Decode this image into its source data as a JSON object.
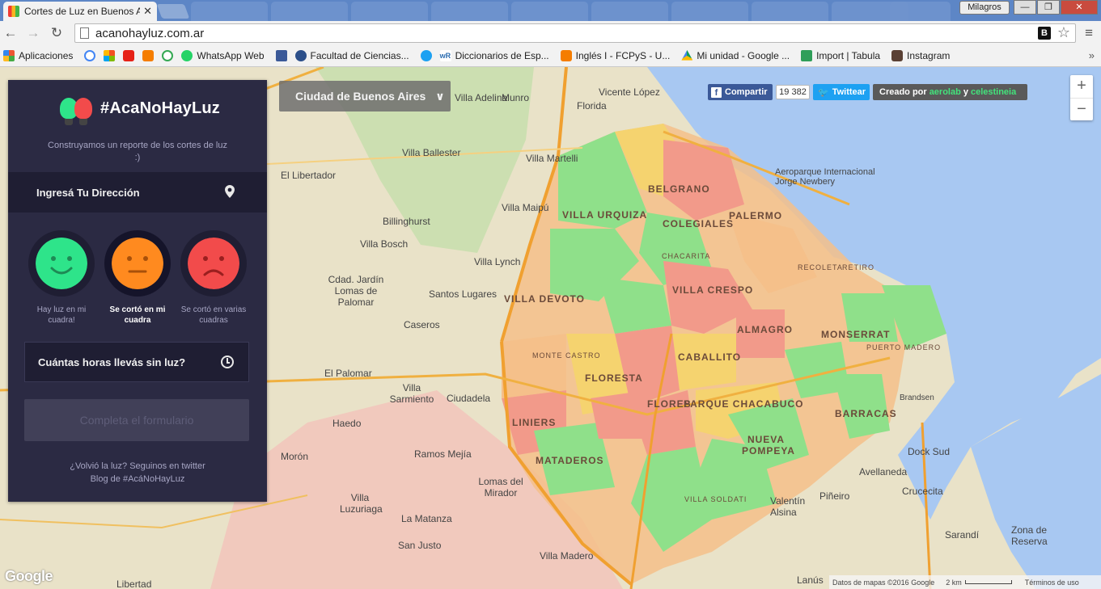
{
  "browser": {
    "tab_title": "Cortes de Luz en Buenos A",
    "profile": "Milagros",
    "url": "acanohayluz.com.ar",
    "bookmarks": [
      {
        "label": "Aplicaciones",
        "icon": "apps-icon"
      },
      {
        "label": "",
        "icon": "google-icon"
      },
      {
        "label": "",
        "icon": "microsoft-icon"
      },
      {
        "label": "",
        "icon": "youtube-icon"
      },
      {
        "label": "",
        "icon": "blogger-icon"
      },
      {
        "label": "",
        "icon": "google-icon"
      },
      {
        "label": "WhatsApp Web",
        "icon": "whatsapp-icon"
      },
      {
        "label": "",
        "icon": "facebook-icon"
      },
      {
        "label": "Facultad de Ciencias...",
        "icon": "faculty-icon"
      },
      {
        "label": "",
        "icon": "twitter-icon"
      },
      {
        "label": "Diccionarios de Esp...",
        "icon": "wordreference-icon"
      },
      {
        "label": "Inglés I - FCPyS - U...",
        "icon": "blogger-icon"
      },
      {
        "label": "Mi unidad - Google ...",
        "icon": "drive-icon"
      },
      {
        "label": "Import | Tabula",
        "icon": "tabula-icon"
      },
      {
        "label": "Instagram",
        "icon": "instagram-icon"
      }
    ],
    "colors": {
      "tabstrip": "#5d86c6",
      "toolbar": "#f2f2f2"
    }
  },
  "panel": {
    "logo_text": "#AcaNoHayLuz",
    "tagline": "Construyamos un reporte de los cortes de luz :)",
    "address_label": "Ingresá Tu Dirección",
    "faces": [
      {
        "label": "Hay luz en mi cuadra!",
        "color": "#2ee48a",
        "mood": "happy",
        "selected": false
      },
      {
        "label": "Se cortó en mi cuadra",
        "color": "#ff8a1f",
        "mood": "neutral",
        "selected": true
      },
      {
        "label": "Se cortó en varias cuadras",
        "color": "#f24b4b",
        "mood": "sad",
        "selected": false
      }
    ],
    "hours_label": "Cuántas horas llevás sin luz?",
    "submit_label": "Completa el formulario",
    "link_twitter": "¿Volvió la luz? Seguinos en twitter",
    "link_blog": "Blog de #AcáNoHayLuz"
  },
  "map_ui": {
    "city_select": "Ciudad de Buenos Aires",
    "share_label": "Compartir",
    "share_count": "19 382",
    "tweet_label": "Twittear",
    "credit_prefix": "Creado por",
    "credit_a": "aerolab",
    "credit_and": "y",
    "credit_b": "celestineia",
    "attribution": "Datos de mapas ©2016 Google",
    "scale": "2 km",
    "terms": "Términos de uso",
    "google": "Google"
  },
  "map_labels": {
    "places": [
      "Vicente López",
      "Florida",
      "Villa Adelina",
      "Munro",
      "Villa Ballester",
      "Villa Martelli",
      "El Libertador",
      "Villa Maipú",
      "Billinghurst",
      "Villa Bosch",
      "Villa Lynch",
      "Cdad. Jardín Lomas de Palomar",
      "Santos Lugares",
      "Caseros",
      "El Palomar",
      "Villa Sarmiento",
      "Ciudadela",
      "Haedo",
      "Ramos Mejía",
      "Morón",
      "Lomas del Mirador",
      "Villa Luzuriaga",
      "La Matanza",
      "San Justo",
      "Villa Madero",
      "Libertad",
      "Aeroparque Internacional Jorge Newbery",
      "Avellaneda",
      "Dock Sud",
      "Crucecita",
      "Piñeiro",
      "Valentín Alsina",
      "Sarandí",
      "Zona de Reserva",
      "Lanús",
      "Brandsen"
    ],
    "hoods": [
      "BELGRANO",
      "VILLA URQUIZA",
      "COLEGIALES",
      "PALERMO",
      "VILLA CRESPO",
      "VILLA DEVOTO",
      "ALMAGRO",
      "MONSERRAT",
      "CABALLITO",
      "FLORESTA",
      "FLORES",
      "PARQUE CHACABUCO",
      "LINIERS",
      "MATADEROS",
      "BARRACAS",
      "NUEVA POMPEYA",
      "CHACARITA",
      "MONTE CASTRO",
      "RECOLETA",
      "RETIRO",
      "PUERTO MADERO",
      "VILLA SOLDATI"
    ]
  },
  "legend_colors": {
    "ok": "#7ee07e",
    "partial": "#f5d36f",
    "cut": "#f29a8a",
    "water": "#a8c8f2"
  }
}
